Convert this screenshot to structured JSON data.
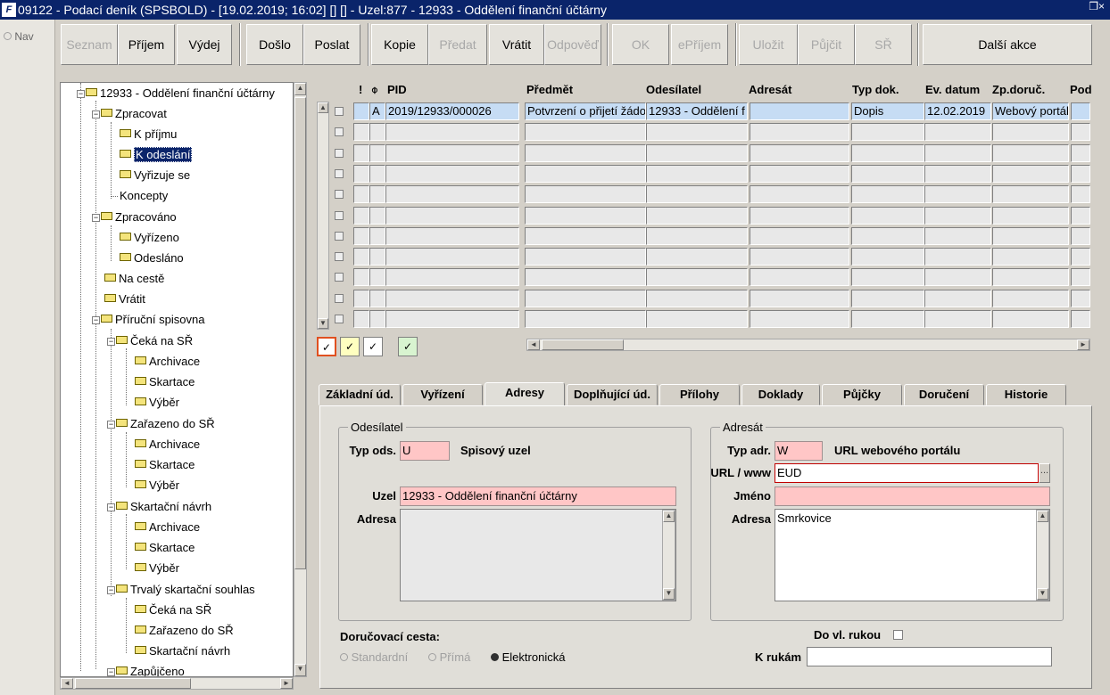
{
  "window": {
    "title": "09122 - Podací deník (SPSBOLD) - [19.02.2019; 16:02]  []  [] - Uzel:877 - 12933 - Oddělení finanční účtárny",
    "icon_letter": "F"
  },
  "nav": {
    "label": "Nav"
  },
  "toolbar": {
    "seznam": "Seznam",
    "prijem": "Příjem",
    "vydej": "Výdej",
    "doslo": "Došlo",
    "poslat": "Poslat",
    "kopie": "Kopie",
    "predat": "Předat",
    "vratit": "Vrátit",
    "odpoved": "Odpověď",
    "ok": "OK",
    "eprijem": "ePříjem",
    "ulozit": "Uložit",
    "pujcit": "Půjčit",
    "sr": "SŘ",
    "dalsi_akce": "Další akce"
  },
  "tree": {
    "root": "12933 - Oddělení finanční účtárny",
    "zpracovat": "Zpracovat",
    "k_prijmu": "K příjmu",
    "k_odeslani": "K odeslání",
    "vyrizuje_se": "Vyřizuje se",
    "koncepty": "Koncepty",
    "zpracovano": "Zpracováno",
    "vyrizeno": "Vyřízeno",
    "odeslano": "Odesláno",
    "na_ceste": "Na cestě",
    "vratit": "Vrátit",
    "prirucni_spisovna": "Příruční spisovna",
    "ceka_na_sr": "Čeká na SŘ",
    "archivace": "Archivace",
    "skartace": "Skartace",
    "vyber": "Výběr",
    "zarazeno_do_sr": "Zařazeno do SŘ",
    "skartacni_navrh": "Skartační návrh",
    "trvaly_souhlas": "Trvalý skartační souhlas",
    "zapujceno": "Zapůjčeno"
  },
  "grid": {
    "headers": {
      "excl": "!",
      "pid": "PID",
      "predmet": "Předmět",
      "odesilatel": "Odesílatel",
      "adresat": "Adresát",
      "typ_dok": "Typ dok.",
      "ev_datum": "Ev. datum",
      "zp_doruc": "Zp.doruč.",
      "pod": "Pod"
    },
    "row1": {
      "flag": "A",
      "pid": "2019/12933/000026",
      "predmet": "Potvrzení o přijetí žádo",
      "odesilatel": "12933 - Oddělení f",
      "adresat": "",
      "typ_dok": "Dopis",
      "ev_datum": "12.02.2019",
      "zp_doruc": "Webový portál"
    },
    "check": "✓"
  },
  "tabs": {
    "zakladni": "Základní úd.",
    "vyrizeni": "Vyřízení",
    "adresy": "Adresy",
    "doplnujici": "Doplňující úd.",
    "prilohy": "Přílohy",
    "doklady": "Doklady",
    "pujcky": "Půjčky",
    "doruceni": "Doručení",
    "historie": "Historie"
  },
  "sender": {
    "legend": "Odesílatel",
    "typ_label": "Typ ods.",
    "typ_value": "U",
    "typ_desc": "Spisový uzel",
    "uzel_label": "Uzel",
    "uzel_value": "12933 - Oddělení finanční účtárny",
    "adresa_label": "Adresa",
    "adresa_value": ""
  },
  "recipient": {
    "legend": "Adresát",
    "typ_label": "Typ adr.",
    "typ_value": "W",
    "typ_desc": "URL webového portálu",
    "url_label": "URL / www",
    "url_value": "EUD",
    "url_btn": "...",
    "jmeno_label": "Jméno",
    "jmeno_value": "",
    "adresa_label": "Adresa",
    "adresa_value": "Smrkovice"
  },
  "delivery": {
    "label": "Doručovací cesta:",
    "options": [
      "Standardní",
      "Přímá",
      "Elektronická"
    ],
    "selected": "Elektronická",
    "do_vl_rukou": "Do vl. rukou",
    "k_rukam": "K rukám",
    "k_rukam_value": ""
  }
}
